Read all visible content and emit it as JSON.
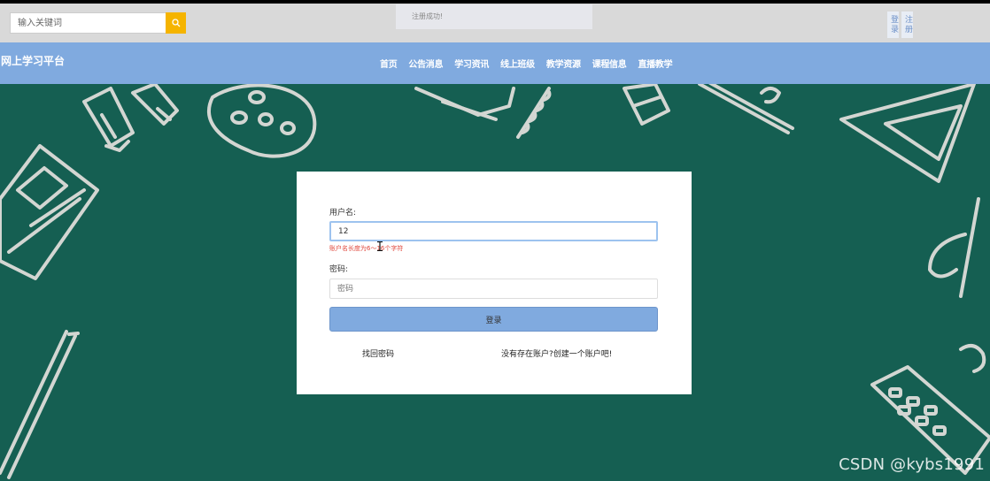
{
  "topbar": {
    "search_placeholder": "输入关键词",
    "toast": "注册成功!",
    "login_link": "登录",
    "register_link": "注册"
  },
  "navbar": {
    "brand": "网上学习平台",
    "items": [
      "首页",
      "公告消息",
      "学习资讯",
      "线上班级",
      "教学资源",
      "课程信息",
      "直播教学"
    ]
  },
  "login_form": {
    "username_label": "用户名:",
    "username_value": "12",
    "username_error": "账户名长度为6～16个字符",
    "password_label": "密码:",
    "password_placeholder": "密码",
    "submit_label": "登录",
    "forgot_link": "找回密码",
    "register_prompt": "没有存在账户?创建一个账户吧!"
  },
  "watermark": "CSDN @kybs1991",
  "colors": {
    "nav_bg": "#80aadf",
    "hero_bg": "#155f52",
    "search_button": "#f5b400",
    "error": "#e0483d"
  },
  "icons": {
    "search_button": "search-icon"
  }
}
